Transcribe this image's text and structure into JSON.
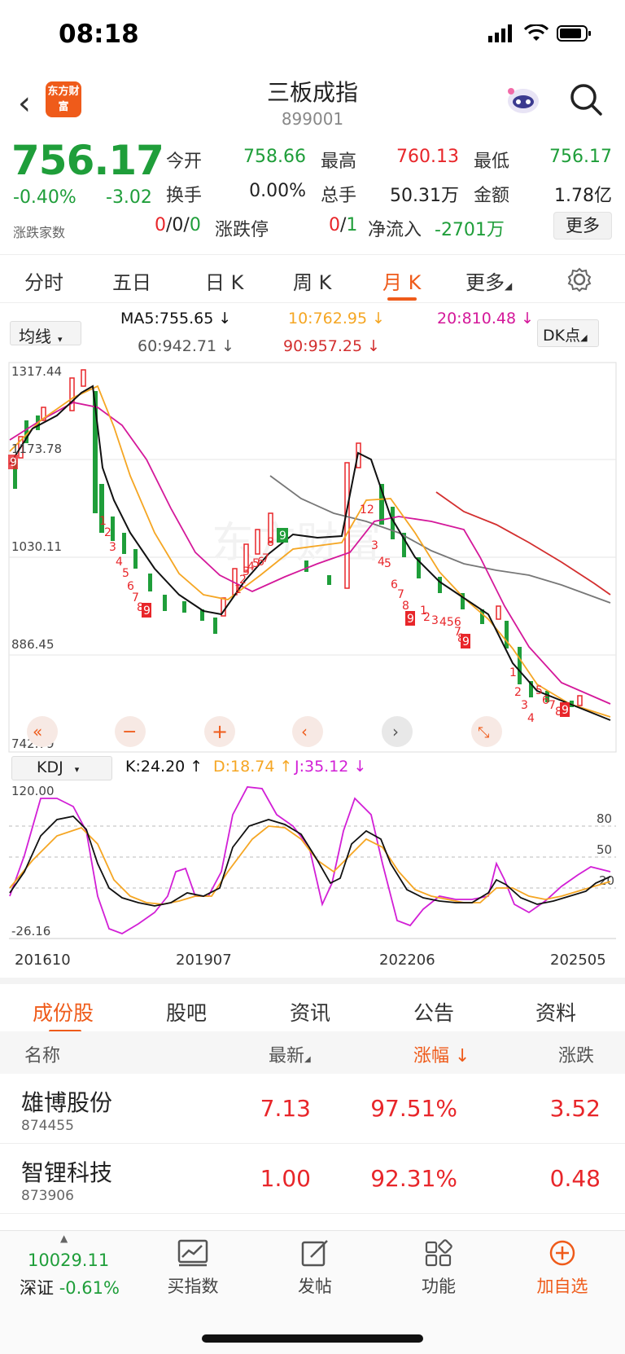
{
  "status": {
    "time": "08:18"
  },
  "header": {
    "logo": "东方财富",
    "title": "三板成指",
    "code": "899001"
  },
  "quote": {
    "price": "756.17",
    "change_pct": "-0.40%",
    "change": "-3.02",
    "fields": [
      {
        "label": "今开",
        "value": "758.66",
        "color": "green"
      },
      {
        "label": "最高",
        "value": "760.13",
        "color": "red"
      },
      {
        "label": "最低",
        "value": "756.17",
        "color": "green"
      },
      {
        "label": "换手",
        "value": "0.00%",
        "color": "dark"
      },
      {
        "label": "总手",
        "value": "50.31万",
        "color": "dark"
      },
      {
        "label": "金额",
        "value": "1.78亿",
        "color": "dark"
      }
    ],
    "updown_label": "涨跌家数",
    "updown": [
      "0",
      "0",
      "0"
    ],
    "limit_label": "涨跌停",
    "limit_up": "0",
    "limit_down": "1",
    "inflow_label": "净流入",
    "inflow": "-2701万",
    "more": "更多"
  },
  "period_tabs": [
    "分时",
    "五日",
    "日 K",
    "周 K",
    "月 K",
    "更多"
  ],
  "active_tab": "月 K",
  "ma": {
    "selector": "均线",
    "ma5": "MA5:755.65",
    "ma10": "10:762.95",
    "ma20": "20:810.48",
    "ma60": "60:942.71",
    "ma90": "90:957.25",
    "dk": "DK点"
  },
  "main_chart_axis": [
    "1317.44",
    "1173.78",
    "1030.11",
    "886.45",
    "742.79"
  ],
  "kdj": {
    "selector": "KDJ",
    "k": "K:24.20",
    "d": "D:18.74",
    "j": "J:35.12",
    "axis_top": "120.00",
    "axis_bottom": "-26.16",
    "levels": [
      "80",
      "50",
      "20"
    ]
  },
  "x_labels": [
    "201610",
    "201907",
    "202206",
    "202505"
  ],
  "chart_data": {
    "type": "line",
    "x": [
      "201610",
      "201907",
      "202206",
      "202505"
    ],
    "ylim_price": [
      742.79,
      1317.44
    ],
    "series": [
      {
        "name": "MA5",
        "values": [
          1150,
          1260,
          1000,
          900,
          950,
          1000,
          1250,
          1000,
          870,
          760
        ]
      },
      {
        "name": "10",
        "values": [
          1180,
          1220,
          1050,
          900,
          930,
          990,
          1150,
          1020,
          900,
          770
        ]
      },
      {
        "name": "20",
        "values": [
          1200,
          1190,
          1100,
          930,
          920,
          980,
          1050,
          1040,
          950,
          810
        ]
      }
    ],
    "kdj_ylim": [
      -26.16,
      120.0
    ]
  },
  "colors": {
    "green": "#1f9e3a",
    "red": "#e8262a",
    "orange": "#ef5b1a",
    "ma5": "#111111",
    "ma10": "#f5a623",
    "ma20": "#d4189a",
    "ma60": "#777777",
    "ma90": "#d32f2f",
    "k": "#111111",
    "d": "#f5a623",
    "j": "#d21fd6"
  },
  "bottom_tabs": [
    "成份股",
    "股吧",
    "资讯",
    "公告",
    "资料"
  ],
  "active_bottom_tab": "成份股",
  "table": {
    "headers": [
      "名称",
      "最新",
      "涨幅",
      "涨跌"
    ],
    "rows": [
      {
        "name": "雄博股份",
        "code": "874455",
        "last": "7.13",
        "pct": "97.51%",
        "chg": "3.52"
      },
      {
        "name": "智锂科技",
        "code": "873906",
        "last": "1.00",
        "pct": "92.31%",
        "chg": "0.48"
      }
    ]
  },
  "bottom_bar": {
    "index_value": "10029.11",
    "index_name": "深证",
    "index_change": "-0.61%",
    "items": [
      "买指数",
      "发帖",
      "功能",
      "加自选"
    ]
  }
}
